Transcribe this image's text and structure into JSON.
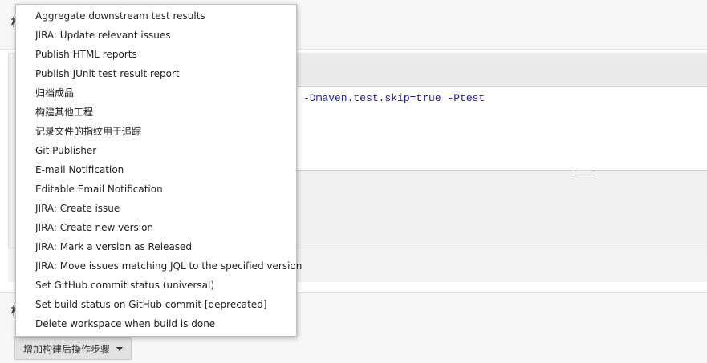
{
  "background": {
    "top_section_glyph": "构",
    "bottom_section_glyph": "构",
    "goals_code_line": "-Dmaven.test.skip=true -Ptest"
  },
  "dropdown": {
    "items": [
      {
        "label": "Aggregate downstream test results"
      },
      {
        "label": "JIRA: Update relevant issues"
      },
      {
        "label": "Publish HTML reports"
      },
      {
        "label": "Publish JUnit test result report"
      },
      {
        "label": "归档成品"
      },
      {
        "label": "构建其他工程"
      },
      {
        "label": "记录文件的指纹用于追踪"
      },
      {
        "label": "Git Publisher"
      },
      {
        "label": "E-mail Notification"
      },
      {
        "label": "Editable Email Notification"
      },
      {
        "label": "JIRA: Create issue"
      },
      {
        "label": "JIRA: Create new version"
      },
      {
        "label": "JIRA: Mark a version as Released"
      },
      {
        "label": "JIRA: Move issues matching JQL to the specified version"
      },
      {
        "label": "Set GitHub commit status (universal)"
      },
      {
        "label": "Set build status on GitHub commit [deprecated]"
      },
      {
        "label": "Delete workspace when build is done"
      }
    ]
  },
  "add_post_build_button": {
    "label": "增加构建后操作步骤",
    "icon": "caret-down-icon"
  },
  "colors": {
    "menu_background": "#ffffff",
    "code_text": "#1a1aa6",
    "panel_background": "#f0f0f0"
  }
}
